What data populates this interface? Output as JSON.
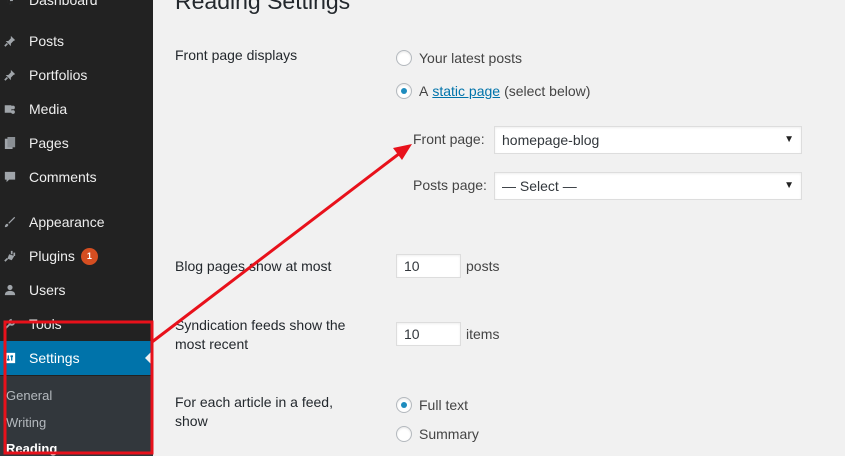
{
  "sidebar": {
    "partial_top_label": "Dashboard",
    "items": [
      {
        "label": "Posts",
        "icon": "pin-icon"
      },
      {
        "label": "Portfolios",
        "icon": "pin-icon"
      },
      {
        "label": "Media",
        "icon": "media-icon"
      },
      {
        "label": "Pages",
        "icon": "pages-icon"
      },
      {
        "label": "Comments",
        "icon": "comment-icon"
      },
      {
        "label": "Appearance",
        "icon": "brush-icon"
      },
      {
        "label": "Plugins",
        "icon": "plugin-icon",
        "badge": "1"
      },
      {
        "label": "Users",
        "icon": "user-icon"
      },
      {
        "label": "Tools",
        "icon": "wrench-icon"
      },
      {
        "label": "Settings",
        "icon": "settings-icon",
        "current": true
      }
    ],
    "submenu": [
      "General",
      "Writing",
      "Reading"
    ]
  },
  "main": {
    "title": "Reading Settings",
    "front_page_displays": {
      "label": "Front page displays",
      "option_latest": "Your latest posts",
      "option_static_prefix": "A",
      "option_static_link": "static page",
      "option_static_suffix": "(select below)",
      "front_page_label": "Front page:",
      "front_page_value": "homepage-blog",
      "posts_page_label": "Posts page:",
      "posts_page_value": "— Select —"
    },
    "blog_pages": {
      "label": "Blog pages show at most",
      "value": "10",
      "unit": "posts"
    },
    "syndication": {
      "label_line1": "Syndication feeds show the",
      "label_line2": "most recent",
      "value": "10",
      "unit": "items"
    },
    "feed_article": {
      "label_line1": "For each article in a feed,",
      "label_line2": "show",
      "option_full": "Full text",
      "option_summary": "Summary"
    }
  },
  "colors": {
    "sidebar_bg": "#222222",
    "current_bg": "#0073aa",
    "accent": "#0073aa",
    "annotation": "#e8111b"
  }
}
